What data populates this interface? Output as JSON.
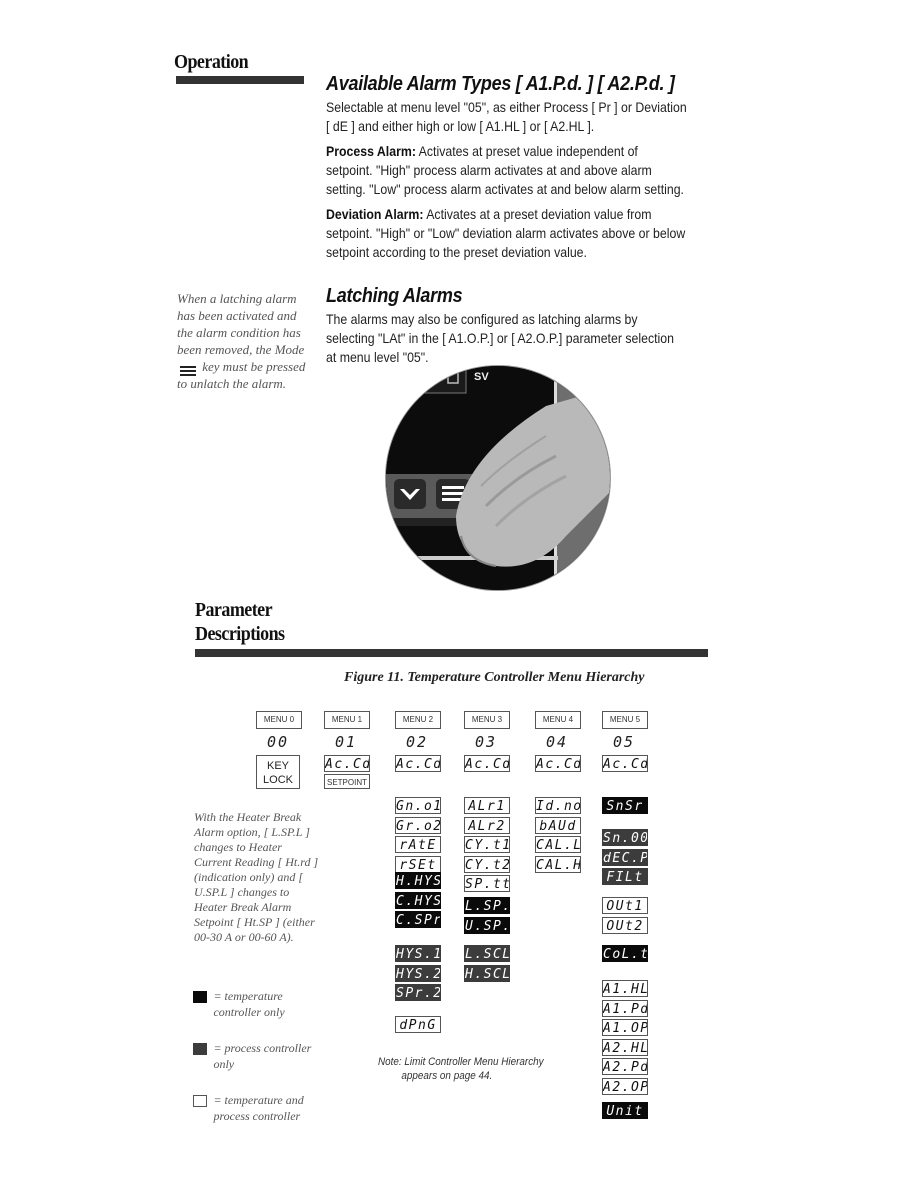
{
  "operation": {
    "title": "Operation",
    "alarm_types": {
      "heading": "Available Alarm Types [ A1.P.d. ] [ A2.P.d. ]",
      "intro": "Selectable at menu level \"05\", as either Process [ Pr ] or Deviation [ dE ] and either high or low [ A1.HL ] or [ A2.HL ].",
      "process_label": "Process Alarm:",
      "process_text": " Activates at preset value independent of setpoint. \"High\" process alarm activates at and above alarm setting. \"Low\" process alarm activates at and below alarm setting.",
      "deviation_label": "Deviation Alarm:",
      "deviation_text": " Activates at a preset deviation value from setpoint. \"High\" or \"Low\" deviation alarm activates above or below setpoint according to the preset deviation value."
    },
    "latching": {
      "heading": "Latching Alarms",
      "text": "The alarms may also be configured as latching alarms by selecting \"LAt\" in the [ A1.O.P.] or [ A2.O.P.] parameter selection at menu level \"05\".",
      "sidenote_before": "When a latching alarm has been activated and the alarm condition has been removed, the Mode",
      "sidenote_after": "key must be pressed to unlatch the alarm.",
      "mode_icon": "mode-key-icon",
      "photo": {
        "sv_label": "SV",
        "icons": [
          "down-arrow-key-icon",
          "mode-key-icon",
          "finger-icon"
        ]
      }
    }
  },
  "parameters": {
    "title_line1": "Parameter",
    "title_line2": "Descriptions",
    "figure_caption": "Figure 11. Temperature Controller Menu Hierarchy",
    "menus": [
      {
        "label": "MENU 0",
        "num": "00"
      },
      {
        "label": "MENU 1",
        "num": "01"
      },
      {
        "label": "MENU 2",
        "num": "02"
      },
      {
        "label": "MENU 3",
        "num": "03"
      },
      {
        "label": "MENU 4",
        "num": "04"
      },
      {
        "label": "MENU 5",
        "num": "05"
      }
    ],
    "keylock_line1": "KEY",
    "keylock_line2": "LOCK",
    "setpoint": "SETPOINT",
    "accd": "Ac.Cd",
    "menu2_groups": [
      [
        {
          "t": "Gn.o1",
          "k": "w"
        },
        {
          "t": "Gr.o2",
          "k": "w"
        },
        {
          "t": "rAtE",
          "k": "w"
        },
        {
          "t": "rSEt",
          "k": "w"
        }
      ],
      [
        {
          "t": "H.HYS",
          "k": "t"
        },
        {
          "t": "C.HYS",
          "k": "t"
        },
        {
          "t": "C.SPr",
          "k": "t"
        }
      ],
      [
        {
          "t": "HYS.1",
          "k": "p"
        },
        {
          "t": "HYS.2",
          "k": "p"
        },
        {
          "t": "SPr.2",
          "k": "p"
        }
      ],
      [
        {
          "t": "dPnG",
          "k": "w"
        }
      ]
    ],
    "menu3_groups": [
      [
        {
          "t": "ALr1",
          "k": "w"
        },
        {
          "t": "ALr2",
          "k": "w"
        },
        {
          "t": "CY.t1",
          "k": "w"
        },
        {
          "t": "CY.t2",
          "k": "w"
        },
        {
          "t": "SP.tt",
          "k": "w"
        }
      ],
      [
        {
          "t": "L.SP.L",
          "k": "t"
        },
        {
          "t": "U.SP.L",
          "k": "t"
        }
      ],
      [
        {
          "t": "L.SCL",
          "k": "p"
        },
        {
          "t": "H.SCL",
          "k": "p"
        }
      ]
    ],
    "menu4_groups": [
      [
        {
          "t": "Id.no",
          "k": "w"
        },
        {
          "t": "bAUd",
          "k": "w"
        },
        {
          "t": "CAL.L",
          "k": "w"
        },
        {
          "t": "CAL.H",
          "k": "w"
        }
      ]
    ],
    "menu5_groups": [
      [
        {
          "t": "SnSr",
          "k": "t"
        }
      ],
      [
        {
          "t": "Sn.00",
          "k": "p"
        },
        {
          "t": "dEC.P",
          "k": "p"
        },
        {
          "t": "FILt",
          "k": "p"
        }
      ],
      [
        {
          "t": "OUt1",
          "k": "w"
        },
        {
          "t": "OUt2",
          "k": "w"
        }
      ],
      [
        {
          "t": "CoL.t",
          "k": "t"
        }
      ],
      [
        {
          "t": "A1.HL",
          "k": "w"
        },
        {
          "t": "A1.Pd",
          "k": "w"
        },
        {
          "t": "A1.OP",
          "k": "w"
        },
        {
          "t": "A2.HL",
          "k": "w"
        },
        {
          "t": "A2.Pd",
          "k": "w"
        },
        {
          "t": "A2.OP",
          "k": "w"
        }
      ],
      [
        {
          "t": "Unit",
          "k": "t"
        }
      ]
    ],
    "heater_note": "With the Heater Break Alarm option, [ L.SP.L ] changes to Heater Current Reading [ Ht.rd ] (indication only) and [ U.SP.L ] changes to Heater Break Alarm Setpoint [ Ht.SP ] (either 00-30 A or 00-60 A).",
    "legend": [
      {
        "swatch": "temperature-only",
        "color": "#0a0a0a",
        "text": "= temperature controller only"
      },
      {
        "swatch": "process-only",
        "color": "#3c3c3c",
        "text": "= process controller only"
      },
      {
        "swatch": "both",
        "color": "#ffffff",
        "text": "= temperature and process controller"
      }
    ],
    "note_line1": "Note: Limit Controller Menu Hierarchy",
    "note_line2": "appears on page 44."
  }
}
